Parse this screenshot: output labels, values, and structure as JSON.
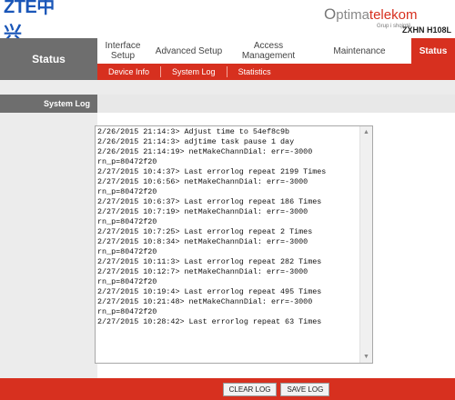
{
  "header": {
    "logo": "ZTE中兴",
    "operator_name_prefix": "O",
    "operator_name_mid": "ptima",
    "operator_name_suffix": "telekom",
    "operator_tagline": "Grup i shqiptë",
    "model": "ZXHN H108L"
  },
  "nav": {
    "current_section": "Status",
    "tabs": [
      {
        "label": "Interface Setup"
      },
      {
        "label": "Advanced Setup"
      },
      {
        "label": "Access Management"
      },
      {
        "label": "Maintenance"
      },
      {
        "label": "Status"
      }
    ],
    "subnav": [
      {
        "label": "Device Info"
      },
      {
        "label": "System Log"
      },
      {
        "label": "Statistics"
      }
    ]
  },
  "section": {
    "label": "System Log"
  },
  "log": {
    "text": "2/26/2015 21:14:3> Adjust time to 54ef8c9b\n2/26/2015 21:14:3> adjtime task pause 1 day\n2/26/2015 21:14:19> netMakeChannDial: err=-3000\nrn_p=80472f20\n2/27/2015 10:4:37> Last errorlog repeat 2199 Times\n2/27/2015 10:6:56> netMakeChannDial: err=-3000\nrn_p=80472f20\n2/27/2015 10:6:37> Last errorlog repeat 186 Times\n2/27/2015 10:7:19> netMakeChannDial: err=-3000\nrn_p=80472f20\n2/27/2015 10:7:25> Last errorlog repeat 2 Times\n2/27/2015 10:8:34> netMakeChannDial: err=-3000\nrn_p=80472f20\n2/27/2015 10:11:3> Last errorlog repeat 282 Times\n2/27/2015 10:12:7> netMakeChannDial: err=-3000\nrn_p=80472f20\n2/27/2015 10:19:4> Last errorlog repeat 495 Times\n2/27/2015 10:21:48> netMakeChannDial: err=-3000\nrn_p=80472f20\n2/27/2015 10:28:42> Last errorlog repeat 63 Times"
  },
  "buttons": {
    "clear": "CLEAR LOG",
    "save": "SAVE LOG"
  },
  "colors": {
    "accent": "#d7301f",
    "sidebar": "#6e6e6e"
  }
}
